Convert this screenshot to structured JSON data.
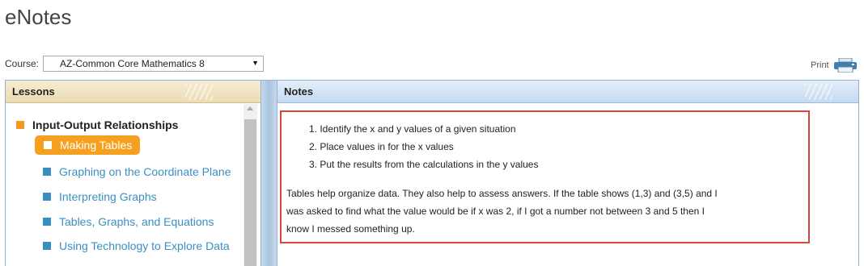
{
  "app": {
    "title": "eNotes"
  },
  "course": {
    "label": "Course:",
    "selected": "AZ-Common Core Mathematics 8",
    "caret": "▼"
  },
  "print": {
    "label": "Print"
  },
  "lessons": {
    "header": "Lessons",
    "items": [
      {
        "label": "Input-Output Relationships",
        "level": 0,
        "selected": false
      },
      {
        "label": "Making Tables",
        "level": 1,
        "selected": true
      },
      {
        "label": "Graphing on the Coordinate Plane",
        "level": 1,
        "selected": false
      },
      {
        "label": "Interpreting Graphs",
        "level": 1,
        "selected": false
      },
      {
        "label": "Tables, Graphs, and Equations",
        "level": 1,
        "selected": false
      },
      {
        "label": "Using Technology to Explore Data",
        "level": 1,
        "selected": false
      }
    ]
  },
  "notes": {
    "header": "Notes",
    "list": [
      "1. Identify the x and y values of a given situation",
      "2. Place values in for the x values",
      "3. Put the results from the calculations in the y values"
    ],
    "paragraph_lines": [
      "Tables help organize data. They also help to assess answers. If the table shows (1,3) and (3,5) and I",
      "was asked to find what the value would be if x was 2, if I got a number not between 3 and 5 then I",
      "know I messed something up."
    ]
  },
  "colors": {
    "accent_orange": "#f5a01e",
    "link_blue": "#3a8fc2",
    "highlight_red": "#d9453f",
    "frame_blue": "#8db2d4"
  },
  "icons": {
    "print": "printer-icon",
    "dropdown": "chevron-down-icon",
    "bullet": "square-bullet-icon"
  }
}
